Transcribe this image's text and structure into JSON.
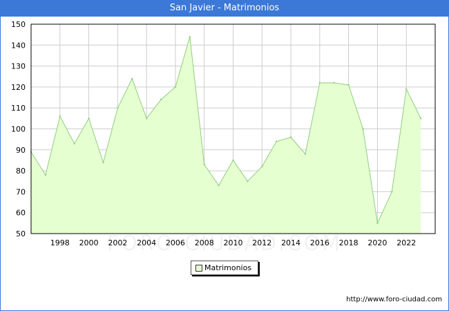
{
  "title": "San Javier - Matrimonios",
  "source_url": "http://www.foro-ciudad.com",
  "watermark": "FORO-CIUDAD.COM",
  "colors": {
    "title_bg": "#3b78d8",
    "fill": "#e6ffd0",
    "line": "#8fce80",
    "grid": "#cccccc"
  },
  "chart_data": {
    "type": "area",
    "title": "San Javier - Matrimonios",
    "xlabel": "",
    "ylabel": "",
    "x": [
      1996,
      1997,
      1998,
      1999,
      2000,
      2001,
      2002,
      2003,
      2004,
      2005,
      2006,
      2007,
      2008,
      2009,
      2010,
      2011,
      2012,
      2013,
      2014,
      2015,
      2016,
      2017,
      2018,
      2019,
      2020,
      2021,
      2022,
      2023
    ],
    "series": [
      {
        "name": "Matrimonios",
        "values": [
          89,
          78,
          106,
          93,
          105,
          84,
          110,
          124,
          105,
          114,
          120,
          144,
          83,
          73,
          85,
          75,
          82,
          94,
          96,
          88,
          122,
          122,
          121,
          100,
          55,
          70,
          119,
          105
        ]
      }
    ],
    "xlim": [
      1996,
      2024
    ],
    "ylim": [
      50,
      150
    ],
    "xticks": [
      "1998",
      "2000",
      "2002",
      "2004",
      "2006",
      "2008",
      "2010",
      "2012",
      "2014",
      "2016",
      "2018",
      "2020",
      "2022"
    ],
    "yticks": [
      "50",
      "60",
      "70",
      "80",
      "90",
      "100",
      "110",
      "120",
      "130",
      "140",
      "150"
    ],
    "grid": true,
    "legend": "bottom-center"
  }
}
